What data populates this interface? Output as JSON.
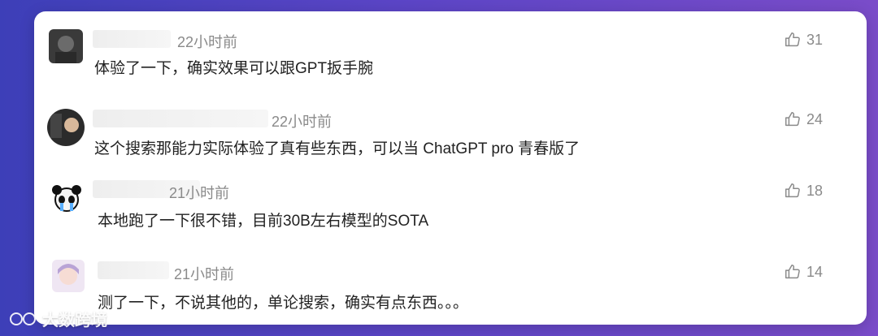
{
  "comments": [
    {
      "time": "22小时前",
      "text": "体验了一下，确实效果可以跟GPT扳手腕",
      "likes": "31"
    },
    {
      "time": "22小时前",
      "text": "这个搜索那能力实际体验了真有些东西，可以当 ChatGPT pro 青春版了",
      "likes": "24"
    },
    {
      "time": "21小时前",
      "text": "本地跑了一下很不错，目前30B左右模型的SOTA",
      "likes": "18"
    },
    {
      "time": "21小时前",
      "text": "测了一下，不说其他的，单论搜索，确实有点东西。。。",
      "likes": "14"
    }
  ],
  "watermark": {
    "text": "大数跨境"
  },
  "icons": {
    "like": "thumbs-up-icon",
    "watermark_logo": "logo-icon"
  }
}
